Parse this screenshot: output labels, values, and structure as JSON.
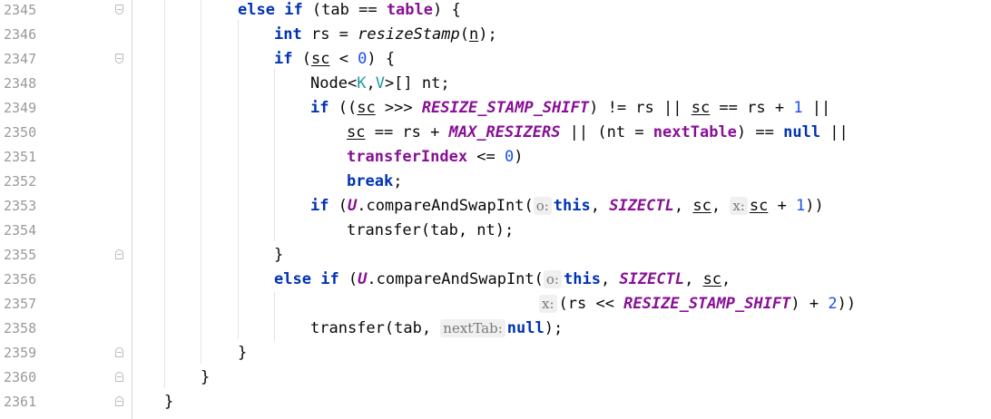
{
  "line_numbers": [
    "2345",
    "2346",
    "2347",
    "2348",
    "2349",
    "2350",
    "2351",
    "2352",
    "2353",
    "2354",
    "2355",
    "2356",
    "2357",
    "2358",
    "2359",
    "2360",
    "2361"
  ],
  "code": {
    "l2345": {
      "kw_else": "else",
      "kw_if": "if",
      "open": " (tab == ",
      "table": "table",
      "close": ") {"
    },
    "l2346": {
      "kw_int": "int",
      "mid": " rs = ",
      "call": "resizeStamp",
      "paren_open": "(",
      "arg": "n",
      "paren_close": ");"
    },
    "l2347": {
      "kw_if": "if",
      "open": " (",
      "sc": "sc",
      "mid": " < ",
      "zero": "0",
      "close": ") {"
    },
    "l2348": {
      "node": "Node<",
      "k": "K",
      "comma": ",",
      "v": "V",
      "rest": ">[] nt;"
    },
    "l2349": {
      "kw_if": "if",
      "open": " ((",
      "sc1": "sc",
      "shift": " >>> ",
      "const": "RESIZE_STAMP_SHIFT",
      "mid1": ") != rs || ",
      "sc2": "sc",
      "mid2": " == rs + ",
      "one": "1",
      "end": " ||"
    },
    "l2350": {
      "sc": "sc",
      "mid1": " == rs + ",
      "const": "MAX_RESIZERS",
      "mid2": " || (nt = ",
      "field": "nextTable",
      "mid3": ") == ",
      "null": "null",
      "end": " ||"
    },
    "l2351": {
      "field": "transferIndex",
      "mid": " <= ",
      "zero": "0",
      "end": ")"
    },
    "l2352": {
      "kw_break": "break",
      "end": ";"
    },
    "l2353": {
      "kw_if": "if",
      "open": " (",
      "u": "U",
      "call": ".compareAndSwapInt(",
      "hint_o": "o:",
      "this": "this",
      "comma1": ", ",
      "const": "SIZECTL",
      "comma2": ", ",
      "sc1": "sc",
      "comma3": ", ",
      "hint_x": "x:",
      "sc2": "sc",
      "plus": " + ",
      "one": "1",
      "end": "))"
    },
    "l2354": {
      "text": "transfer(tab, nt);"
    },
    "l2355": {
      "brace": "}"
    },
    "l2356": {
      "kw_else": "else",
      "kw_if": "if",
      "open": " (",
      "u": "U",
      "call": ".compareAndSwapInt(",
      "hint_o": "o:",
      "this": "this",
      "comma1": ", ",
      "const": "SIZECTL",
      "comma2": ", ",
      "sc": "sc",
      "end": ","
    },
    "l2357": {
      "hint_x": "x:",
      "open": "(rs << ",
      "const": "RESIZE_STAMP_SHIFT",
      "mid": ") + ",
      "two": "2",
      "end": "))"
    },
    "l2358": {
      "text": "transfer(tab, ",
      "hint": "nextTab:",
      "null": "null",
      "end": ");"
    },
    "l2359": {
      "brace": "}"
    },
    "l2360": {
      "brace": "}"
    },
    "l2361": {
      "brace": "}"
    }
  },
  "colors": {
    "keyword": "#0033b3",
    "field": "#871094",
    "number": "#1750eb",
    "type_param": "#20999d",
    "line_number": "#9a9a9a"
  }
}
